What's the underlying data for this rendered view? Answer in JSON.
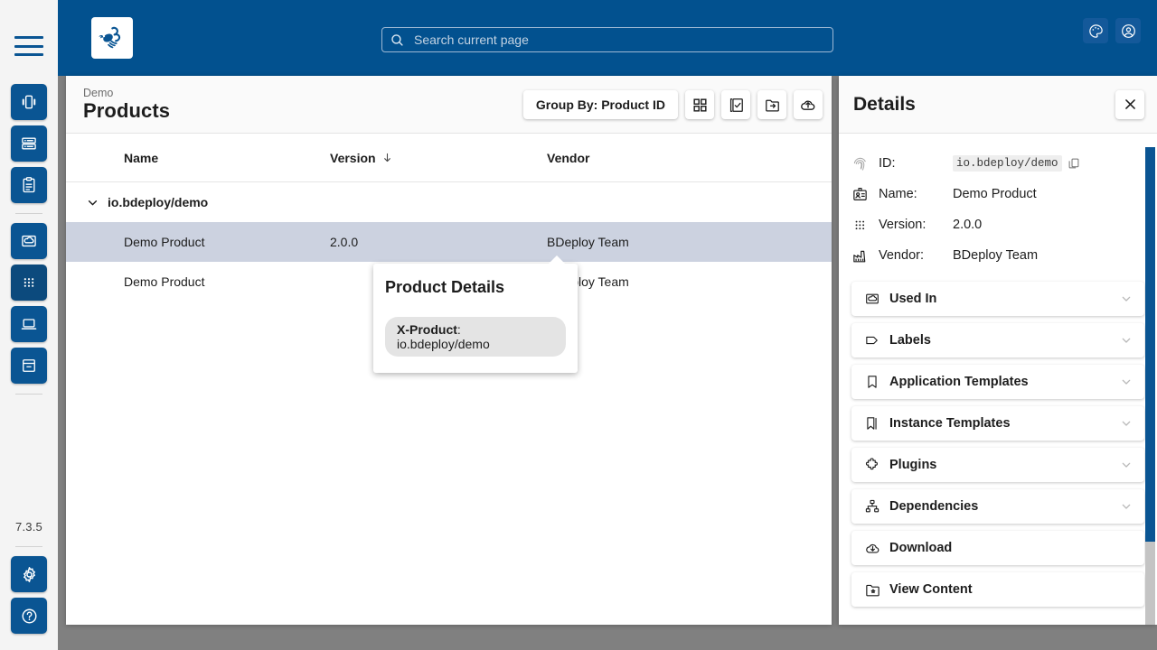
{
  "app": {
    "logo_icon": "bee-logo-icon",
    "version": "7.3.5",
    "accent_color": "#0a5593",
    "header_color": "#02518f"
  },
  "search": {
    "placeholder": "Search current page",
    "value": "",
    "icon": "search-icon"
  },
  "topbar": {
    "actions": [
      {
        "name": "theme-button",
        "icon": "palette-icon"
      },
      {
        "name": "user-account-button",
        "icon": "user-circle-icon"
      }
    ]
  },
  "sidebar": {
    "menu_icon": "hamburger-menu-icon",
    "items": [
      {
        "name": "sidebar-item-instances",
        "icon": "instance-group-icon",
        "active": false
      },
      {
        "name": "sidebar-item-servers",
        "icon": "server-list-icon",
        "active": false
      },
      {
        "name": "sidebar-item-reports",
        "icon": "clipboard-icon",
        "active": false
      },
      {
        "name": "sidebar-item-software-repos",
        "icon": "cloud-box-icon",
        "active": false
      },
      {
        "name": "sidebar-item-products",
        "icon": "grid-dots-icon",
        "active": true
      },
      {
        "name": "sidebar-item-client-apps",
        "icon": "laptop-icon",
        "active": false
      },
      {
        "name": "sidebar-item-archive",
        "icon": "archive-box-icon",
        "active": false
      }
    ],
    "bottom_items": [
      {
        "name": "settings-button",
        "icon": "gear-icon"
      },
      {
        "name": "help-button",
        "icon": "help-circle-icon"
      }
    ]
  },
  "main": {
    "breadcrumb": "Demo",
    "title": "Products",
    "toolbar": {
      "group_by_label": "Group By: Product ID",
      "buttons": [
        {
          "name": "card-view-button",
          "icon": "grid-view-icon"
        },
        {
          "name": "bulk-select-button",
          "icon": "checkbox-stack-icon"
        },
        {
          "name": "import-product-button",
          "icon": "folder-import-icon"
        },
        {
          "name": "upload-product-button",
          "icon": "cloud-upload-icon"
        }
      ]
    },
    "table": {
      "columns": [
        {
          "label": "Name",
          "sorted": false
        },
        {
          "label": "Version",
          "sorted": true,
          "sort_icon": "arrow-down-icon"
        },
        {
          "label": "Vendor",
          "sorted": false
        }
      ],
      "groups": [
        {
          "label": "io.bdeploy/demo",
          "expanded": true,
          "chevron_icon": "chevron-down-icon",
          "rows": [
            {
              "name": "Demo Product",
              "version": "2.0.0",
              "vendor": "BDeploy Team",
              "selected": true
            },
            {
              "name": "Demo Product",
              "version": "",
              "vendor": "BDeploy Team",
              "selected": false
            }
          ]
        }
      ]
    },
    "popover": {
      "title": "Product Details",
      "chip_key": "X-Product",
      "chip_sep": ": ",
      "chip_value": "io.bdeploy/demo"
    }
  },
  "details": {
    "title": "Details",
    "close_icon": "close-icon",
    "fields": [
      {
        "icon": "fingerprint-icon",
        "label": "ID:",
        "value": "io.bdeploy/demo",
        "mono": true,
        "copy_icon": "copy-icon"
      },
      {
        "icon": "id-badge-icon",
        "label": "Name:",
        "value": "Demo Product",
        "mono": false
      },
      {
        "icon": "grid-dots-icon",
        "label": "Version:",
        "value": "2.0.0",
        "mono": false
      },
      {
        "icon": "factory-icon",
        "label": "Vendor:",
        "value": "BDeploy Team",
        "mono": false
      }
    ],
    "sections": [
      {
        "label": "Used In",
        "icon": "cloud-box-icon",
        "expandable": true,
        "chevron_icon": "chevron-down-icon"
      },
      {
        "label": "Labels",
        "icon": "tag-icon",
        "expandable": true,
        "chevron_icon": "chevron-down-icon"
      },
      {
        "label": "Application Templates",
        "icon": "bookmark-icon",
        "expandable": true,
        "chevron_icon": "chevron-down-icon"
      },
      {
        "label": "Instance Templates",
        "icon": "bookmark-stack-icon",
        "expandable": true,
        "chevron_icon": "chevron-down-icon"
      },
      {
        "label": "Plugins",
        "icon": "puzzle-icon",
        "expandable": true,
        "chevron_icon": "chevron-down-icon"
      },
      {
        "label": "Dependencies",
        "icon": "hierarchy-icon",
        "expandable": true,
        "chevron_icon": "chevron-down-icon"
      },
      {
        "label": "Download",
        "icon": "cloud-download-icon",
        "expandable": false
      },
      {
        "label": "View Content",
        "icon": "folder-star-icon",
        "expandable": false
      }
    ]
  }
}
